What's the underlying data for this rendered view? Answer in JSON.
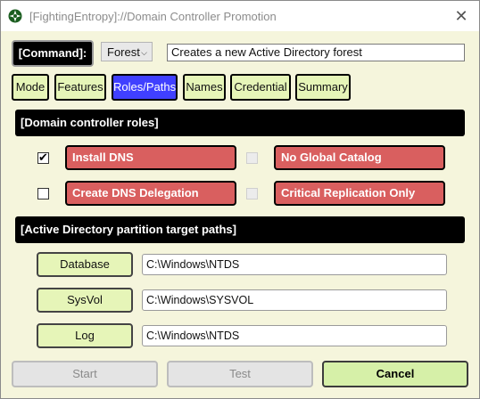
{
  "window": {
    "title": "[FightingEntropy]://Domain Controller Promotion",
    "close_glyph": "✕"
  },
  "command": {
    "label": "[Command]:",
    "selected": "Forest",
    "description": "Creates a new Active Directory forest"
  },
  "tabs": [
    {
      "label": "Mode"
    },
    {
      "label": "Features"
    },
    {
      "label": "Roles/Paths"
    },
    {
      "label": "Names"
    },
    {
      "label": "Credential"
    },
    {
      "label": "Summary"
    }
  ],
  "active_tab": "Roles/Paths",
  "roles": {
    "header": "[Domain controller roles]",
    "items": [
      {
        "label": "Install DNS",
        "checked": true,
        "enabled": true
      },
      {
        "label": "No Global Catalog",
        "checked": false,
        "enabled": false
      },
      {
        "label": "Create DNS Delegation",
        "checked": false,
        "enabled": true
      },
      {
        "label": "Critical Replication Only",
        "checked": false,
        "enabled": false
      }
    ]
  },
  "paths": {
    "header": "[Active Directory partition target paths]",
    "items": [
      {
        "label": "Database",
        "value": "C:\\Windows\\NTDS"
      },
      {
        "label": "SysVol",
        "value": "C:\\Windows\\SYSVOL"
      },
      {
        "label": "Log",
        "value": "C:\\Windows\\NTDS"
      }
    ]
  },
  "buttons": {
    "start": "Start",
    "test": "Test",
    "cancel": "Cancel"
  },
  "colors": {
    "client_bg": "#f5f5dc",
    "tab_bg": "#e6f5b8",
    "tab_active": "#4040ff",
    "role_red": "#d95f5f",
    "header_black": "#000000"
  }
}
